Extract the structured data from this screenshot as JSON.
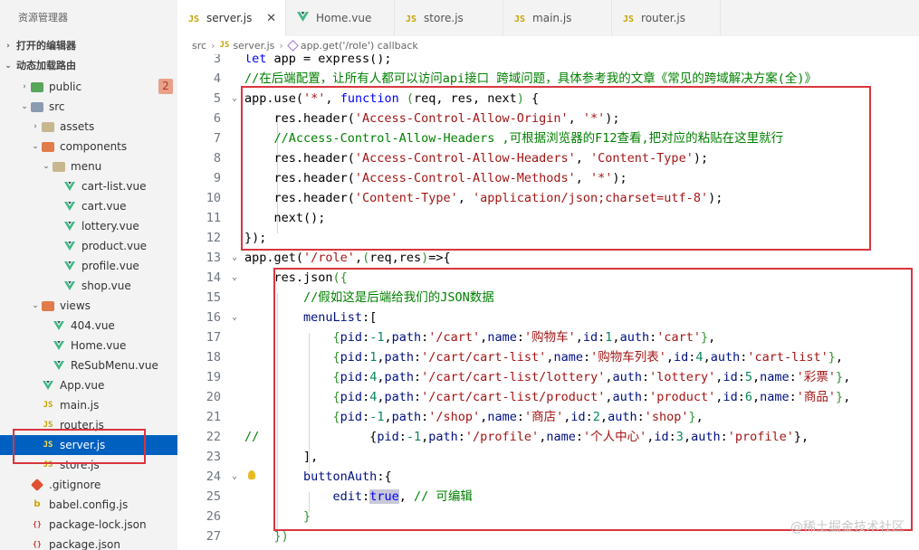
{
  "sidebar": {
    "title": "资源管理器",
    "sections": [
      {
        "label": "打开的编辑器",
        "expanded": false
      },
      {
        "label": "动态加载路由",
        "expanded": true
      }
    ],
    "tree": [
      {
        "label": "public",
        "icon": "folder-icon",
        "depth": 0,
        "chevron": "right",
        "badge": "2"
      },
      {
        "label": "src",
        "icon": "folder-icon",
        "depth": 0,
        "chevron": "down"
      },
      {
        "label": "assets",
        "icon": "folder-icon",
        "depth": 1,
        "chevron": "right"
      },
      {
        "label": "components",
        "icon": "folder-icon",
        "depth": 1,
        "chevron": "down"
      },
      {
        "label": "menu",
        "icon": "folder-icon",
        "depth": 2,
        "chevron": "down"
      },
      {
        "label": "cart-list.vue",
        "icon": "vue-icon",
        "depth": 3
      },
      {
        "label": "cart.vue",
        "icon": "vue-icon",
        "depth": 3
      },
      {
        "label": "lottery.vue",
        "icon": "vue-icon",
        "depth": 3
      },
      {
        "label": "product.vue",
        "icon": "vue-icon",
        "depth": 3
      },
      {
        "label": "profile.vue",
        "icon": "vue-icon",
        "depth": 3
      },
      {
        "label": "shop.vue",
        "icon": "vue-icon",
        "depth": 3
      },
      {
        "label": "views",
        "icon": "folder-icon",
        "depth": 1,
        "chevron": "down"
      },
      {
        "label": "404.vue",
        "icon": "vue-icon",
        "depth": 2
      },
      {
        "label": "Home.vue",
        "icon": "vue-icon",
        "depth": 2
      },
      {
        "label": "ReSubMenu.vue",
        "icon": "vue-icon",
        "depth": 2
      },
      {
        "label": "App.vue",
        "icon": "vue-icon",
        "depth": 1
      },
      {
        "label": "main.js",
        "icon": "js-icon",
        "depth": 1
      },
      {
        "label": "router.js",
        "icon": "js-icon",
        "depth": 1
      },
      {
        "label": "server.js",
        "icon": "js-icon",
        "depth": 1,
        "selected": true
      },
      {
        "label": "store.js",
        "icon": "js-icon",
        "depth": 1
      },
      {
        "label": ".gitignore",
        "icon": "git-icon",
        "depth": 0
      },
      {
        "label": "babel.config.js",
        "icon": "babel-icon",
        "depth": 0
      },
      {
        "label": "package-lock.json",
        "icon": "json-icon",
        "depth": 0
      },
      {
        "label": "package.json",
        "icon": "json-icon",
        "depth": 0
      }
    ]
  },
  "tabs": [
    {
      "label": "server.js",
      "icon": "js-icon",
      "active": true,
      "close": "✕"
    },
    {
      "label": "Home.vue",
      "icon": "vue-icon"
    },
    {
      "label": "store.js",
      "icon": "js-icon"
    },
    {
      "label": "main.js",
      "icon": "js-icon"
    },
    {
      "label": "router.js",
      "icon": "js-icon"
    }
  ],
  "breadcrumb": {
    "parts": [
      "src",
      "server.js",
      "app.get('/role') callback"
    ]
  },
  "editor": {
    "lines": [
      {
        "n": "3",
        "fold": "",
        "tokens": [
          [
            "kw",
            "let "
          ],
          [
            "plain",
            "app = express();"
          ]
        ]
      },
      {
        "n": "4",
        "fold": "",
        "tokens": [
          [
            "com",
            "//在后端配置，让所有人都可以访问api接口 跨域问题，具体参考我的文章《常见的跨域解决方案(全)》"
          ]
        ]
      },
      {
        "n": "5",
        "fold": "v",
        "tokens": [
          [
            "plain",
            "app.use("
          ],
          [
            "str",
            "'*'"
          ],
          [
            "plain",
            ", "
          ],
          [
            "kw",
            "function "
          ],
          [
            "br",
            "("
          ],
          [
            "plain",
            "req, res, next"
          ],
          [
            "br",
            ")"
          ],
          [
            "plain",
            " {"
          ]
        ]
      },
      {
        "n": "6",
        "fold": "",
        "tokens": [
          [
            "plain",
            "    res.header("
          ],
          [
            "str",
            "'Access-Control-Allow-Origin'"
          ],
          [
            "plain",
            ", "
          ],
          [
            "str",
            "'*'"
          ],
          [
            "plain",
            ");"
          ]
        ]
      },
      {
        "n": "7",
        "fold": "",
        "tokens": [
          [
            "com",
            "    //Access-Control-Allow-Headers ,可根据浏览器的F12查看,把对应的粘贴在这里就行"
          ]
        ]
      },
      {
        "n": "8",
        "fold": "",
        "tokens": [
          [
            "plain",
            "    res.header("
          ],
          [
            "str",
            "'Access-Control-Allow-Headers'"
          ],
          [
            "plain",
            ", "
          ],
          [
            "str",
            "'Content-Type'"
          ],
          [
            "plain",
            ");"
          ]
        ]
      },
      {
        "n": "9",
        "fold": "",
        "tokens": [
          [
            "plain",
            "    res.header("
          ],
          [
            "str",
            "'Access-Control-Allow-Methods'"
          ],
          [
            "plain",
            ", "
          ],
          [
            "str",
            "'*'"
          ],
          [
            "plain",
            ");"
          ]
        ]
      },
      {
        "n": "10",
        "fold": "",
        "tokens": [
          [
            "plain",
            "    res.header("
          ],
          [
            "str",
            "'Content-Type'"
          ],
          [
            "plain",
            ", "
          ],
          [
            "str",
            "'application/json;charset=utf-8'"
          ],
          [
            "plain",
            ");"
          ]
        ]
      },
      {
        "n": "11",
        "fold": "",
        "tokens": [
          [
            "plain",
            "    next();"
          ]
        ]
      },
      {
        "n": "12",
        "fold": "",
        "tokens": [
          [
            "plain",
            "});"
          ]
        ]
      },
      {
        "n": "13",
        "fold": "v",
        "tokens": [
          [
            "plain",
            "app.get("
          ],
          [
            "str",
            "'/role'"
          ],
          [
            "plain",
            ","
          ],
          [
            "br",
            "("
          ],
          [
            "plain",
            "req,res"
          ],
          [
            "br",
            ")"
          ],
          [
            "plain",
            "=>{"
          ]
        ]
      },
      {
        "n": "14",
        "fold": "v",
        "tokens": [
          [
            "plain",
            "    res.json"
          ],
          [
            "br",
            "({"
          ]
        ]
      },
      {
        "n": "15",
        "fold": "",
        "tokens": [
          [
            "com",
            "        //假如这是后端给我们的JSON数据"
          ]
        ]
      },
      {
        "n": "16",
        "fold": "v",
        "tokens": [
          [
            "prop",
            "        menuList"
          ],
          [
            "plain",
            ":["
          ]
        ]
      },
      {
        "n": "17",
        "fold": "",
        "tokens": [
          [
            "br",
            "            {"
          ],
          [
            "prop",
            "pid"
          ],
          [
            "plain",
            ":"
          ],
          [
            "num",
            "-1"
          ],
          [
            "plain",
            ","
          ],
          [
            "prop",
            "path"
          ],
          [
            "plain",
            ":"
          ],
          [
            "str",
            "'/cart'"
          ],
          [
            "plain",
            ","
          ],
          [
            "prop",
            "name"
          ],
          [
            "plain",
            ":"
          ],
          [
            "str",
            "'购物车'"
          ],
          [
            "plain",
            ","
          ],
          [
            "prop",
            "id"
          ],
          [
            "plain",
            ":"
          ],
          [
            "num",
            "1"
          ],
          [
            "plain",
            ","
          ],
          [
            "prop",
            "auth"
          ],
          [
            "plain",
            ":"
          ],
          [
            "str",
            "'cart'"
          ],
          [
            "br",
            "}"
          ],
          [
            "plain",
            ","
          ]
        ]
      },
      {
        "n": "18",
        "fold": "",
        "tokens": [
          [
            "br",
            "            {"
          ],
          [
            "prop",
            "pid"
          ],
          [
            "plain",
            ":"
          ],
          [
            "num",
            "1"
          ],
          [
            "plain",
            ","
          ],
          [
            "prop",
            "path"
          ],
          [
            "plain",
            ":"
          ],
          [
            "str",
            "'/cart/cart-list'"
          ],
          [
            "plain",
            ","
          ],
          [
            "prop",
            "name"
          ],
          [
            "plain",
            ":"
          ],
          [
            "str",
            "'购物车列表'"
          ],
          [
            "plain",
            ","
          ],
          [
            "prop",
            "id"
          ],
          [
            "plain",
            ":"
          ],
          [
            "num",
            "4"
          ],
          [
            "plain",
            ","
          ],
          [
            "prop",
            "auth"
          ],
          [
            "plain",
            ":"
          ],
          [
            "str",
            "'cart-list'"
          ],
          [
            "br",
            "}"
          ],
          [
            "plain",
            ","
          ]
        ]
      },
      {
        "n": "19",
        "fold": "",
        "tokens": [
          [
            "br",
            "            {"
          ],
          [
            "prop",
            "pid"
          ],
          [
            "plain",
            ":"
          ],
          [
            "num",
            "4"
          ],
          [
            "plain",
            ","
          ],
          [
            "prop",
            "path"
          ],
          [
            "plain",
            ":"
          ],
          [
            "str",
            "'/cart/cart-list/lottery'"
          ],
          [
            "plain",
            ","
          ],
          [
            "prop",
            "auth"
          ],
          [
            "plain",
            ":"
          ],
          [
            "str",
            "'lottery'"
          ],
          [
            "plain",
            ","
          ],
          [
            "prop",
            "id"
          ],
          [
            "plain",
            ":"
          ],
          [
            "num",
            "5"
          ],
          [
            "plain",
            ","
          ],
          [
            "prop",
            "name"
          ],
          [
            "plain",
            ":"
          ],
          [
            "str",
            "'彩票'"
          ],
          [
            "br",
            "}"
          ],
          [
            "plain",
            ","
          ]
        ]
      },
      {
        "n": "20",
        "fold": "",
        "tokens": [
          [
            "br",
            "            {"
          ],
          [
            "prop",
            "pid"
          ],
          [
            "plain",
            ":"
          ],
          [
            "num",
            "4"
          ],
          [
            "plain",
            ","
          ],
          [
            "prop",
            "path"
          ],
          [
            "plain",
            ":"
          ],
          [
            "str",
            "'/cart/cart-list/product'"
          ],
          [
            "plain",
            ","
          ],
          [
            "prop",
            "auth"
          ],
          [
            "plain",
            ":"
          ],
          [
            "str",
            "'product'"
          ],
          [
            "plain",
            ","
          ],
          [
            "prop",
            "id"
          ],
          [
            "plain",
            ":"
          ],
          [
            "num",
            "6"
          ],
          [
            "plain",
            ","
          ],
          [
            "prop",
            "name"
          ],
          [
            "plain",
            ":"
          ],
          [
            "str",
            "'商品'"
          ],
          [
            "br",
            "}"
          ],
          [
            "plain",
            ","
          ]
        ]
      },
      {
        "n": "21",
        "fold": "",
        "tokens": [
          [
            "br",
            "            {"
          ],
          [
            "prop",
            "pid"
          ],
          [
            "plain",
            ":"
          ],
          [
            "num",
            "-1"
          ],
          [
            "plain",
            ","
          ],
          [
            "prop",
            "path"
          ],
          [
            "plain",
            ":"
          ],
          [
            "str",
            "'/shop'"
          ],
          [
            "plain",
            ","
          ],
          [
            "prop",
            "name"
          ],
          [
            "plain",
            ":"
          ],
          [
            "str",
            "'商店'"
          ],
          [
            "plain",
            ","
          ],
          [
            "prop",
            "id"
          ],
          [
            "plain",
            ":"
          ],
          [
            "num",
            "2"
          ],
          [
            "plain",
            ","
          ],
          [
            "prop",
            "auth"
          ],
          [
            "plain",
            ":"
          ],
          [
            "str",
            "'shop'"
          ],
          [
            "br",
            "}"
          ],
          [
            "plain",
            ","
          ]
        ]
      },
      {
        "n": "22",
        "fold": "",
        "tokens": [
          [
            "com",
            "//"
          ],
          [
            "plain",
            "               {"
          ],
          [
            "prop",
            "pid"
          ],
          [
            "plain",
            ":"
          ],
          [
            "num",
            "-1"
          ],
          [
            "plain",
            ","
          ],
          [
            "prop",
            "path"
          ],
          [
            "plain",
            ":"
          ],
          [
            "str",
            "'/profile'"
          ],
          [
            "plain",
            ","
          ],
          [
            "prop",
            "name"
          ],
          [
            "plain",
            ":"
          ],
          [
            "str",
            "'个人中心'"
          ],
          [
            "plain",
            ","
          ],
          [
            "prop",
            "id"
          ],
          [
            "plain",
            ":"
          ],
          [
            "num",
            "3"
          ],
          [
            "plain",
            ","
          ],
          [
            "prop",
            "auth"
          ],
          [
            "plain",
            ":"
          ],
          [
            "str",
            "'profile'"
          ],
          [
            "plain",
            "},"
          ]
        ]
      },
      {
        "n": "23",
        "fold": "",
        "tokens": [
          [
            "plain",
            "        ],"
          ]
        ]
      },
      {
        "n": "24",
        "fold": "v",
        "bulb": true,
        "tokens": [
          [
            "prop",
            "        buttonAuth"
          ],
          [
            "plain",
            ":{"
          ]
        ]
      },
      {
        "n": "25",
        "fold": "",
        "tokens": [
          [
            "prop",
            "            edit"
          ],
          [
            "plain",
            ":"
          ],
          [
            "bool",
            "true"
          ],
          [
            "plain",
            ", "
          ],
          [
            "com",
            "// 可编辑"
          ]
        ]
      },
      {
        "n": "26",
        "fold": "",
        "tokens": [
          [
            "br",
            "        }"
          ]
        ]
      },
      {
        "n": "27",
        "fold": "",
        "tokens": [
          [
            "br",
            "    })"
          ]
        ]
      }
    ]
  },
  "watermark": "@稀土掘金技术社区",
  "colors": {
    "annotation": "#d9363e",
    "selected_row": "#0060c0"
  }
}
